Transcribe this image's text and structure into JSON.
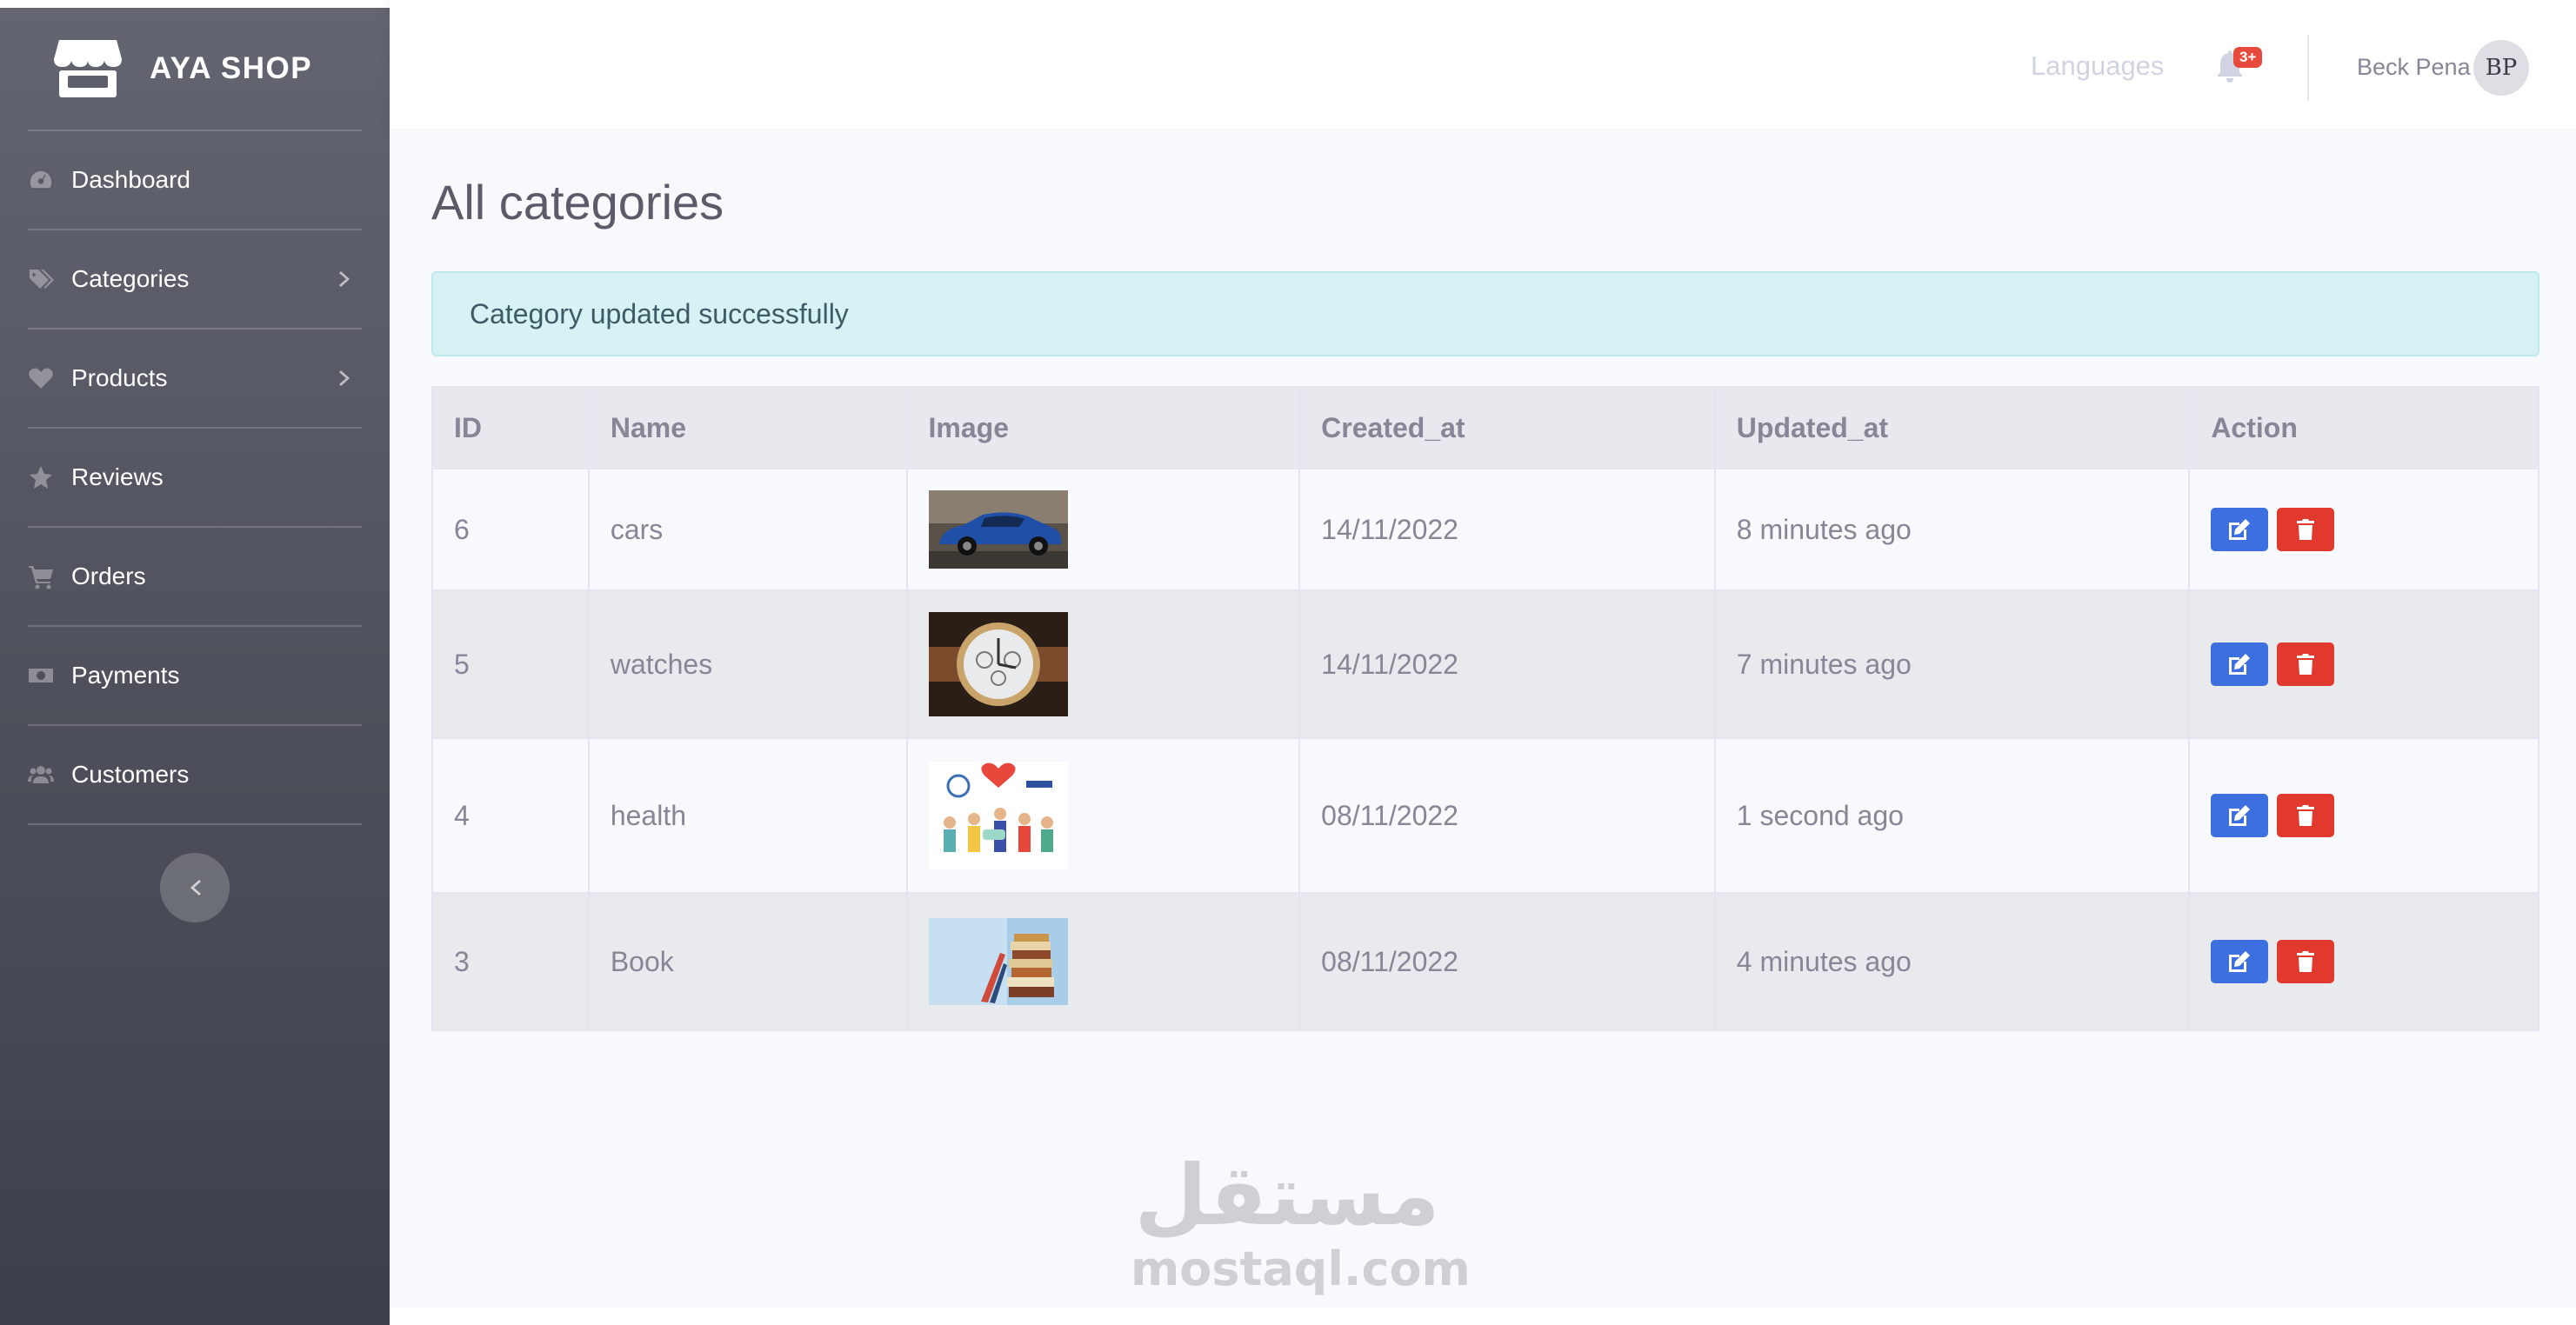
{
  "brand": {
    "name": "AYA SHOP",
    "icon": "store-icon"
  },
  "sidebar": {
    "items": [
      {
        "label": "Dashboard",
        "icon": "dashboard-gauge-icon",
        "has_submenu": false
      },
      {
        "label": "Categories",
        "icon": "tags-icon",
        "has_submenu": true
      },
      {
        "label": "Products",
        "icon": "heart-icon",
        "has_submenu": true
      },
      {
        "label": "Reviews",
        "icon": "star-icon",
        "has_submenu": false
      },
      {
        "label": "Orders",
        "icon": "cart-icon",
        "has_submenu": false
      },
      {
        "label": "Payments",
        "icon": "money-bill-icon",
        "has_submenu": false
      },
      {
        "label": "Customers",
        "icon": "users-icon",
        "has_submenu": false
      }
    ]
  },
  "topbar": {
    "languages_label": "Languages",
    "notification_badge": "3+",
    "user_name": "Beck Pena",
    "user_initials": "BP"
  },
  "main": {
    "title": "All categories",
    "alert": "Category updated successfully",
    "table": {
      "columns": [
        "ID",
        "Name",
        "Image",
        "Created_at",
        "Updated_at",
        "Action"
      ],
      "rows": [
        {
          "id": "6",
          "name": "cars",
          "image": "car",
          "created_at": "14/11/2022",
          "updated_at": "8 minutes ago"
        },
        {
          "id": "5",
          "name": "watches",
          "image": "watch",
          "created_at": "14/11/2022",
          "updated_at": "7 minutes ago"
        },
        {
          "id": "4",
          "name": "health",
          "image": "health",
          "created_at": "08/11/2022",
          "updated_at": "1 second ago"
        },
        {
          "id": "3",
          "name": "Book",
          "image": "books",
          "created_at": "08/11/2022",
          "updated_at": "4 minutes ago"
        }
      ]
    }
  },
  "watermark": {
    "arabic": "مستقل",
    "latin": "mostaql.com"
  },
  "colors": {
    "primary": "#3e6fe0",
    "danger": "#e1392e",
    "alert_bg": "#d7f2f4",
    "sidebar_dark": "#3d3f4b"
  }
}
